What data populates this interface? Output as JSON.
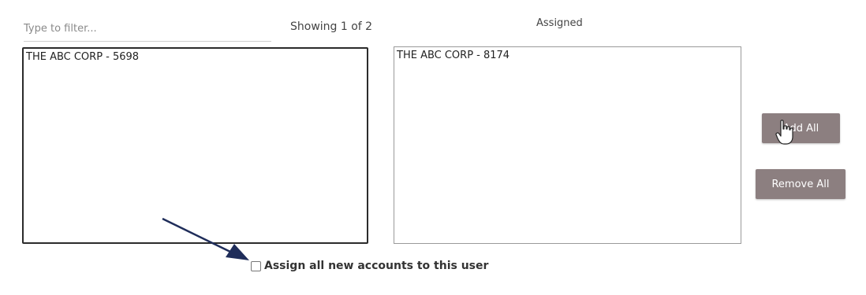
{
  "filter": {
    "placeholder": "Type to filter...",
    "value": ""
  },
  "available": {
    "showing_text": "Showing 1 of 2",
    "items": [
      "THE ABC CORP - 5698"
    ]
  },
  "assigned": {
    "header": "Assigned",
    "items": [
      "THE ABC CORP - 8174"
    ]
  },
  "buttons": {
    "add_all": "Add All",
    "remove_all": "Remove All"
  },
  "assign_new": {
    "label": "Assign all new accounts to this user",
    "checked": false
  },
  "colors": {
    "button_bg": "#8c7f80",
    "arrow": "#1f2d5a",
    "selected_border": "#2b2b2b"
  },
  "annotation": {
    "icon": "arrow-icon"
  },
  "cursor": {
    "icon": "hand-pointer-icon"
  }
}
